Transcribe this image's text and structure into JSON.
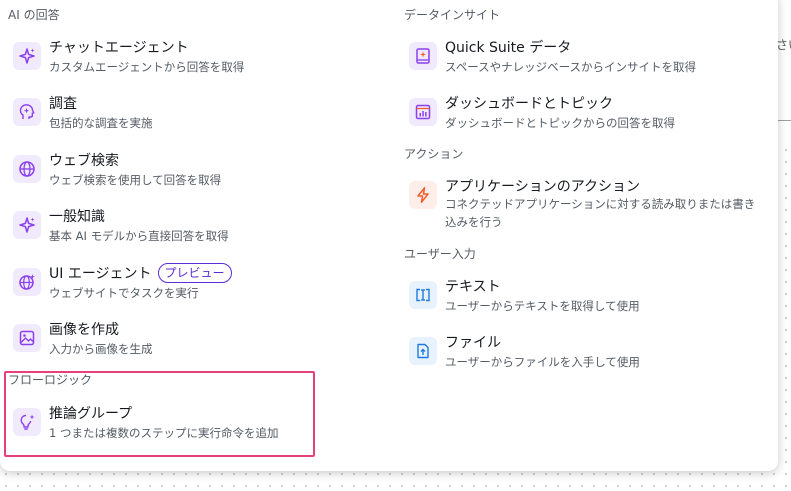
{
  "background": {
    "fragment_text": "さい"
  },
  "left": {
    "ai_section": "AI の回答",
    "items": [
      {
        "title": "チャットエージェント",
        "desc": "カスタムエージェントから回答を取得",
        "icon": "sparkle-icon"
      },
      {
        "title": "調査",
        "desc": "包括的な調査を実施",
        "icon": "research-head-icon"
      },
      {
        "title": "ウェブ検索",
        "desc": "ウェブ検索を使用して回答を取得",
        "icon": "globe-icon"
      },
      {
        "title": "一般知識",
        "desc": "基本 AI モデルから直接回答を取得",
        "icon": "sparkle-icon"
      },
      {
        "title": "UI エージェント",
        "badge": "プレビュー",
        "desc": "ウェブサイトでタスクを実行",
        "icon": "globe-sparkle-icon"
      },
      {
        "title": "画像を作成",
        "desc": "入力から画像を生成",
        "icon": "image-icon"
      }
    ],
    "flow_section": "フローロジック",
    "flow_items": [
      {
        "title": "推論グループ",
        "desc": "1 つまたは複数のステップに実行命令を追加",
        "icon": "lightbulb-icon"
      }
    ]
  },
  "right": {
    "data_section": "データインサイト",
    "data_items": [
      {
        "title": "Quick Suite データ",
        "desc": "スペースやナレッジベースからインサイトを取得",
        "icon": "data-book-icon"
      },
      {
        "title": "ダッシュボードとトピック",
        "desc": "ダッシュボードとトピックからの回答を取得",
        "icon": "dashboard-icon"
      }
    ],
    "action_section": "アクション",
    "action_items": [
      {
        "title": "アプリケーションのアクション",
        "desc": "コネクテッドアプリケーションに対する読み取りまたは書き込みを行う",
        "icon": "lightning-icon"
      }
    ],
    "input_section": "ユーザー入力",
    "input_items": [
      {
        "title": "テキスト",
        "desc": "ユーザーからテキストを取得して使用",
        "icon": "text-cursor-icon"
      },
      {
        "title": "ファイル",
        "desc": "ユーザーからファイルを入手して使用",
        "icon": "file-upload-icon"
      }
    ]
  },
  "colors": {
    "accent_purple": "#8b3ff0",
    "accent_orange": "#f25c2a",
    "accent_blue": "#1f7ae0",
    "highlight": "#e8407a"
  }
}
